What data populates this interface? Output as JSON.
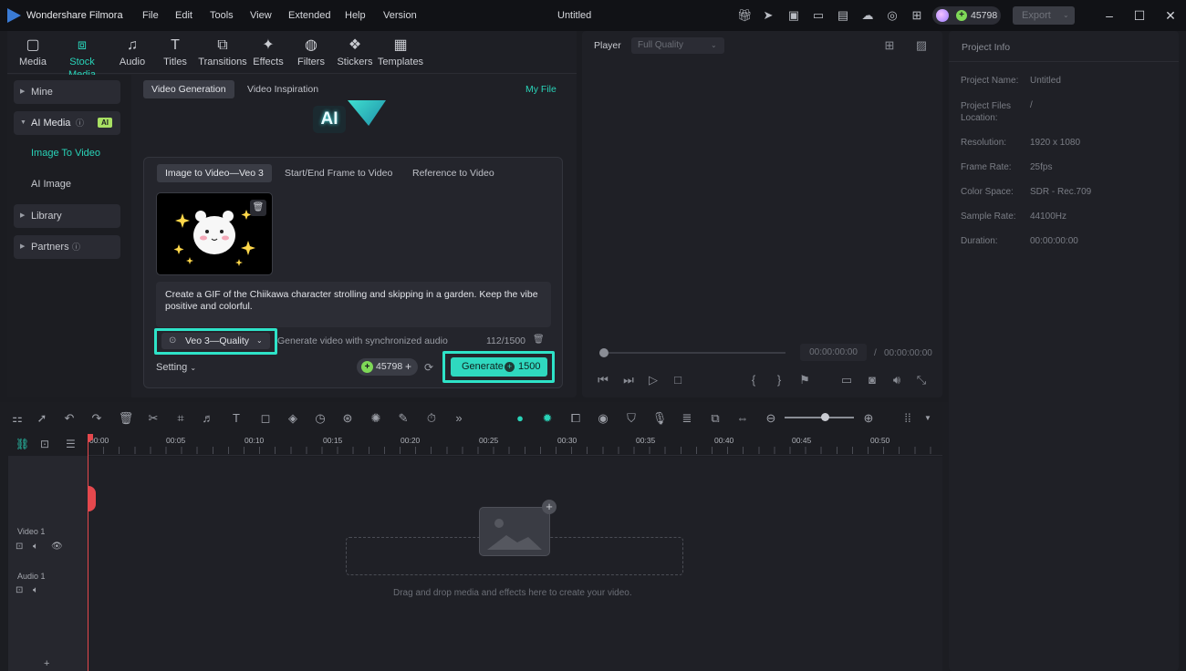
{
  "app": {
    "name": "Wondershare Filmora",
    "document_title": "Untitled",
    "credits": "45798",
    "export_label": "Export"
  },
  "menu": [
    "File",
    "Edit",
    "Tools",
    "View",
    "Extended",
    "Help",
    "Version"
  ],
  "media_toolbar": [
    {
      "label": "Media",
      "icon": "media-icon"
    },
    {
      "label": "Stock Media",
      "icon": "stock-media-icon"
    },
    {
      "label": "Audio",
      "icon": "music-note-icon"
    },
    {
      "label": "Titles",
      "icon": "text-t-icon"
    },
    {
      "label": "Transitions",
      "icon": "transition-icon"
    },
    {
      "label": "Effects",
      "icon": "effects-icon"
    },
    {
      "label": "Filters",
      "icon": "filter-icon"
    },
    {
      "label": "Stickers",
      "icon": "sticker-icon"
    },
    {
      "label": "Templates",
      "icon": "templates-icon"
    }
  ],
  "sidebar": {
    "mine": "Mine",
    "ai_media": "AI Media",
    "ai_badge": "AI",
    "image_to_video": "Image To Video",
    "ai_image": "AI Image",
    "library": "Library",
    "partners": "Partners"
  },
  "content": {
    "tab_generation": "Video Generation",
    "tab_inspiration": "Video Inspiration",
    "my_file": "My File",
    "ai_logo_text": "AI",
    "subtabs": [
      "Image to Video—Veo 3",
      "Start/End Frame to Video",
      "Reference to Video"
    ],
    "prompt": "Create a GIF of the Chiikawa character strolling and skipping in a garden. Keep the vibe positive and colorful.",
    "model": "Veo 3—Quality",
    "audio_option": "Generate video with synchronized audio",
    "char_count": "112/1500",
    "setting": "Setting",
    "credits": "45798",
    "generate": "Generate",
    "generate_cost": "1500"
  },
  "player": {
    "label": "Player",
    "quality": "Full Quality",
    "current_time": "00:00:00:00",
    "separator": "/",
    "total_time": "00:00:00:00"
  },
  "project_info": {
    "title": "Project Info",
    "fields": [
      {
        "label": "Project Name:",
        "value": "Untitled"
      },
      {
        "label": "Project Files Location:",
        "value": "/"
      },
      {
        "label": "Resolution:",
        "value": "1920 x 1080"
      },
      {
        "label": "Frame Rate:",
        "value": "25fps"
      },
      {
        "label": "Color Space:",
        "value": "SDR - Rec.709"
      },
      {
        "label": "Sample Rate:",
        "value": "44100Hz"
      },
      {
        "label": "Duration:",
        "value": "00:00:00:00"
      }
    ]
  },
  "timeline": {
    "ticks": [
      "00:00",
      "00:05",
      "00:10",
      "00:15",
      "00:20",
      "00:25",
      "00:30",
      "00:35",
      "00:40",
      "00:45",
      "00:50"
    ],
    "tracks": [
      {
        "name": "Video 1"
      },
      {
        "name": "Audio 1"
      }
    ],
    "drop_hint": "Drag and drop media and effects here to create your video.",
    "add_track": "+"
  },
  "colors": {
    "accent": "#29d3b8",
    "highlight_border": "#2ee3c8",
    "generate_bg": "#2fd8bf",
    "playhead": "#e5484d",
    "background": "#1b1c21",
    "panel": "#22232a"
  }
}
